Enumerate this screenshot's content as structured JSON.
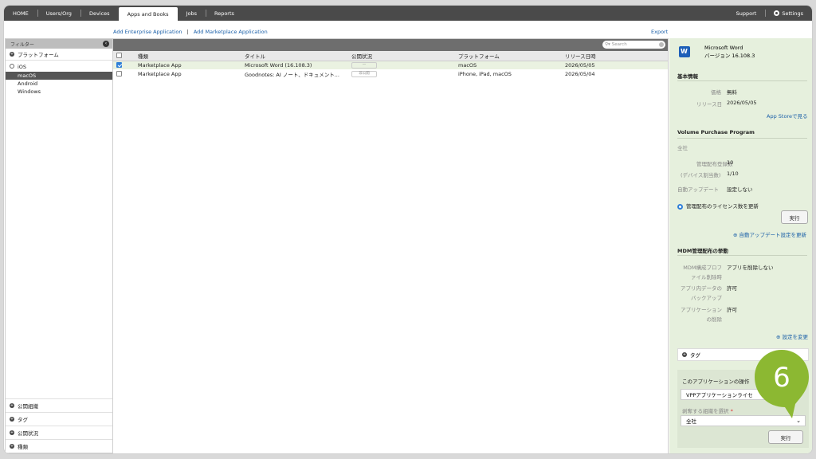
{
  "nav": {
    "home": "HOME",
    "users": "Users/Org",
    "devices": "Devices",
    "apps": "Apps and Books",
    "jobs": "Jobs",
    "reports": "Reports",
    "support": "Support",
    "settings": "Settings"
  },
  "actions": {
    "add_enterprise": "Add Enterprise Application",
    "separator": "|",
    "add_marketplace": "Add Marketplace Application",
    "export": "Export"
  },
  "sidebar": {
    "filter_label": "フィルター",
    "collapse": "‹",
    "platform_section": "プラットフォーム",
    "tree": {
      "parent": "iOS",
      "items": [
        "macOS",
        "Android",
        "Windows"
      ]
    },
    "bottom_sections": [
      "公開組織",
      "タグ",
      "公開状況",
      "種類"
    ]
  },
  "search": {
    "placeholder": "Search"
  },
  "table": {
    "headers": [
      "種類",
      "タイトル",
      "公開状況",
      "プラットフォーム",
      "リリース日時"
    ],
    "rows": [
      {
        "type": "Marketplace App",
        "title": "Microsoft Word (16.108.3)",
        "status": "—",
        "platform": "macOS",
        "date": "2026/05/05",
        "checked": true
      },
      {
        "type": "Marketplace App",
        "title": "Goodnotes: AI ノート、ドキュメント...",
        "status": "非公開",
        "platform": "iPhone, iPad, macOS",
        "date": "2026/05/04",
        "checked": false
      }
    ]
  },
  "detail": {
    "app_name": "Microsoft Word",
    "app_version": "バージョン 16.108.3",
    "basic_title": "基本情報",
    "price_k": "価格",
    "price_v": "無料",
    "release_k": "リリース日",
    "release_v": "2026/05/05",
    "appstore_link": "App Storeで見る",
    "vpp_title": "Volume Purchase Program",
    "vpp_scope": "全社",
    "managed_count_k": "管理配布登録数",
    "managed_count_v": "10",
    "device_assign_k": "(デバイス割当数)",
    "device_assign_v": "1/10",
    "auto_update_k": "自動アップデート",
    "auto_update_v": "設定しない",
    "radio_label": "管理配布のライセンス数を更新",
    "run_button": "実行",
    "auto_update_link": "自動アップデート設定を更新",
    "mdm_title": "MDM管理配布の挙動",
    "mdm_k1a": "MDM構成プロフ",
    "mdm_k1b": "ァイル削除時",
    "mdm_v1": "アプリを削除しない",
    "mdm_k2a": "アプリ内データの",
    "mdm_k2b": "バックアップ",
    "mdm_v2": "許可",
    "mdm_k3a": "アプリケーション",
    "mdm_k3b": "の削除",
    "mdm_v3": "許可",
    "change_link": "設定を変更",
    "tag_label": "タグ",
    "ops_title": "このアプリケーションの操作",
    "ops_select": "VPPアプリケーションライセ",
    "org_label": "剥奪する組織を選択",
    "required_mark": "*",
    "org_select": "全社",
    "ops_run": "実行"
  },
  "callout": {
    "number": "6",
    "color": "#8cb832"
  }
}
